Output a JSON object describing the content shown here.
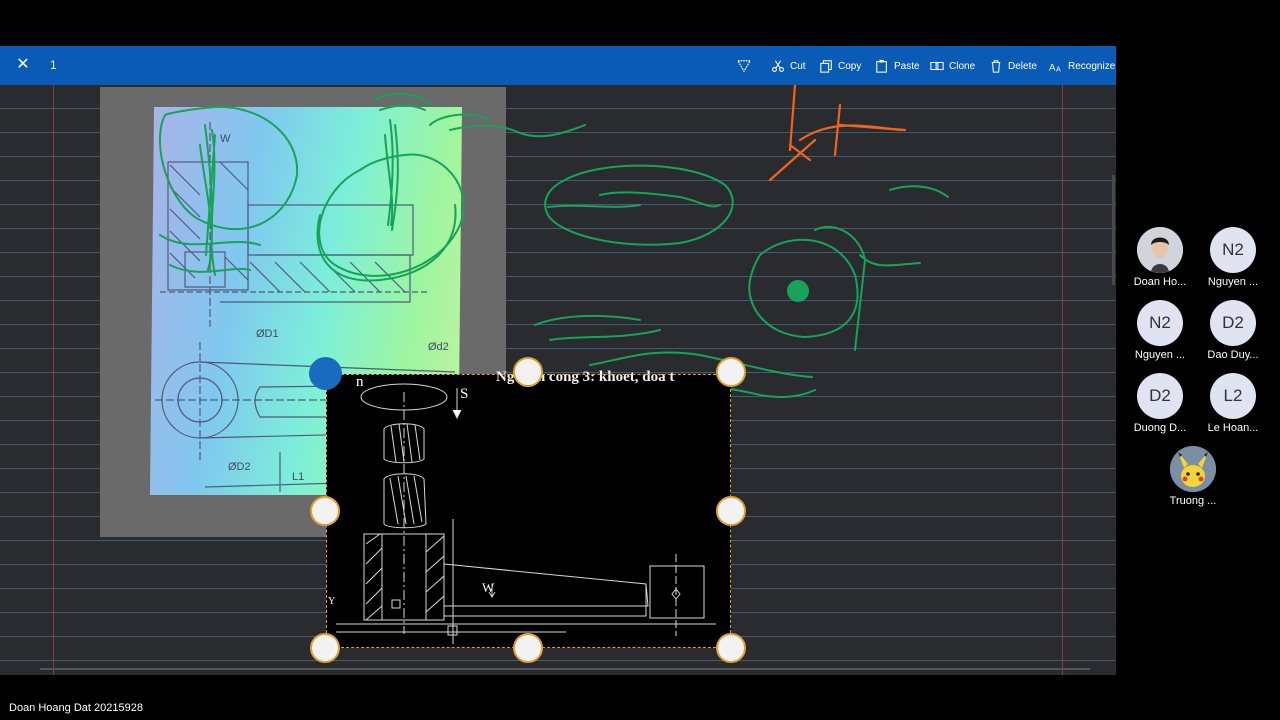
{
  "toolbar": {
    "close_icon": "close-icon",
    "selection_count": "1",
    "items": [
      {
        "label": "",
        "icon": "lasso-icon"
      },
      {
        "label": "Cut",
        "icon": "scissors-icon"
      },
      {
        "label": "Copy",
        "icon": "copy-icon"
      },
      {
        "label": "Paste",
        "icon": "paste-icon"
      },
      {
        "label": "Clone",
        "icon": "clone-icon"
      },
      {
        "label": "Delete",
        "icon": "trash-icon"
      },
      {
        "label": "Recognize",
        "icon": "recognize-icon"
      }
    ],
    "color": "#0a5bb5"
  },
  "drawing_photo": {
    "labels": {
      "w": "W",
      "d1": "ØD1",
      "d2_top": "Ød2",
      "d2_bottom": "ØD2",
      "l1": "L1"
    }
  },
  "selected_image": {
    "title": "Nguyen cong 3: khoet, doa t",
    "labels": {
      "n": "n",
      "s": "S",
      "w": "W",
      "y": "Y"
    }
  },
  "participants": [
    {
      "initials": "",
      "name": "Doan Ho...",
      "avatar": "photo"
    },
    {
      "initials": "N2",
      "name": "Nguyen ..."
    },
    {
      "initials": "N2",
      "name": "Nguyen ..."
    },
    {
      "initials": "D2",
      "name": "Dao Duy..."
    },
    {
      "initials": "D2",
      "name": "Duong D..."
    },
    {
      "initials": "L2",
      "name": "Le Hoan..."
    },
    {
      "initials": "",
      "name": "Truong ...",
      "avatar": "pikachu"
    }
  ],
  "presenter_label": "Doan Hoang Dat 20215928",
  "colors": {
    "ink_green": "#17a35a",
    "ink_orange": "#f0651e",
    "selection_border": "#e0a030",
    "rotate_handle": "#1a6bc0"
  }
}
